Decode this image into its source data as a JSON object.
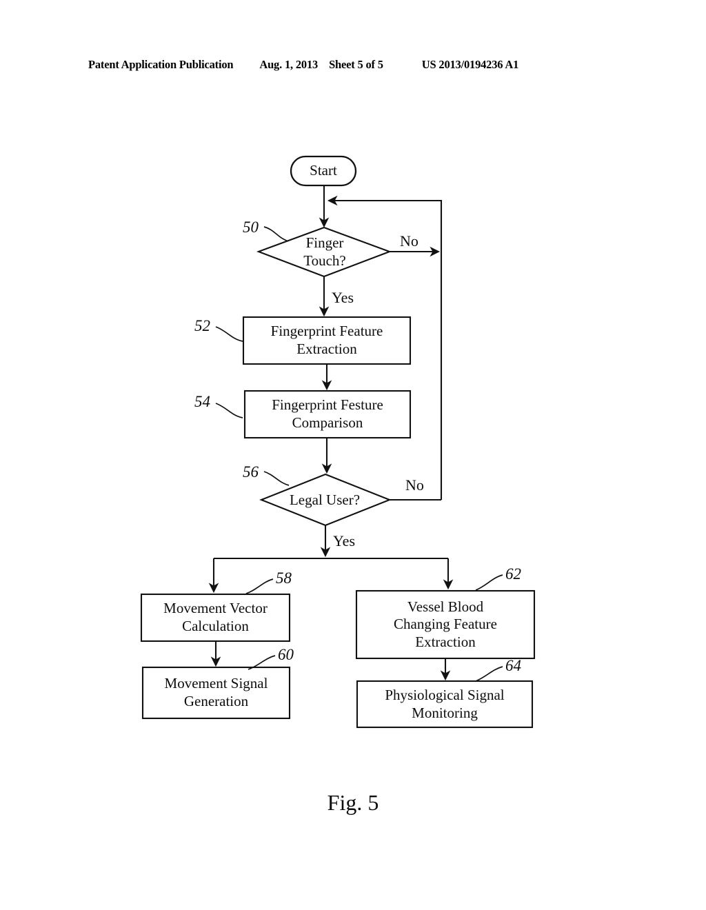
{
  "header": {
    "publication": "Patent Application Publication",
    "date": "Aug. 1, 2013",
    "sheet": "Sheet 5 of 5",
    "patent_number": "US 2013/0194236 A1"
  },
  "figure": {
    "caption": "Fig. 5",
    "line_color": "#111111"
  },
  "flowchart": {
    "start": {
      "label": "Start",
      "shape": "rounded-terminator"
    },
    "decisions": [
      {
        "ref": "50",
        "label": "Finger\nTouch?",
        "yes_label": "Yes",
        "no_label": "No"
      },
      {
        "ref": "56",
        "label": "Legal User?",
        "yes_label": "Yes",
        "no_label": "No"
      }
    ],
    "processes": [
      {
        "ref": "52",
        "label": "Fingerprint Feature\nExtraction"
      },
      {
        "ref": "54",
        "label": "Fingerprint Festure\nComparison"
      },
      {
        "ref": "58",
        "label": "Movement Vector\nCalculation"
      },
      {
        "ref": "60",
        "label": "Movement Signal\nGeneration"
      },
      {
        "ref": "62",
        "label": "Vessel Blood\nChanging Feature\nExtraction"
      },
      {
        "ref": "64",
        "label": "Physiological Signal\nMonitoring"
      }
    ],
    "branch_labels": {
      "finger_touch_no": "No",
      "finger_touch_yes": "Yes",
      "legal_user_no": "No",
      "legal_user_yes": "Yes"
    },
    "ref_numbers": [
      "50",
      "52",
      "54",
      "56",
      "58",
      "60",
      "62",
      "64"
    ]
  }
}
